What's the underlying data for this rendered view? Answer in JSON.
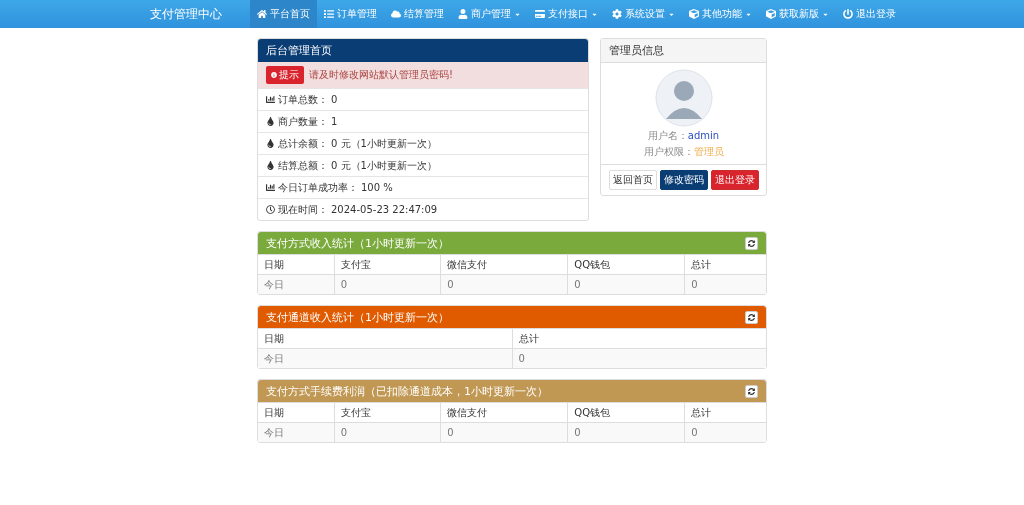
{
  "navbar": {
    "brand": "支付管理中心",
    "items": [
      {
        "label": "平台首页",
        "kind": "home",
        "dropdown": false,
        "selected": true
      },
      {
        "label": "订单管理",
        "kind": "list",
        "dropdown": false,
        "selected": false
      },
      {
        "label": "结算管理",
        "kind": "cloud",
        "dropdown": false,
        "selected": false
      },
      {
        "label": "商户管理",
        "kind": "user",
        "dropdown": true,
        "selected": false
      },
      {
        "label": "支付接口",
        "kind": "card",
        "dropdown": true,
        "selected": false
      },
      {
        "label": "系统设置",
        "kind": "cog",
        "dropdown": true,
        "selected": false
      },
      {
        "label": "其他功能",
        "kind": "cube",
        "dropdown": true,
        "selected": false
      },
      {
        "label": "获取新版",
        "kind": "cube",
        "dropdown": true,
        "selected": false
      },
      {
        "label": "退出登录",
        "kind": "power",
        "dropdown": false,
        "selected": false
      }
    ]
  },
  "overview": {
    "title": "后台管理首页",
    "alert": {
      "badge": "提示",
      "message": "请及时修改网站默认管理员密码!"
    },
    "rows": [
      {
        "kind": "chart",
        "label": "订单总数：",
        "value": "0"
      },
      {
        "kind": "drop",
        "label": "商户数量：",
        "value": "1"
      },
      {
        "kind": "drop",
        "label": "总计余额：",
        "value": "0 元（1小时更新一次）"
      },
      {
        "kind": "drop",
        "label": "结算总额：",
        "value": "0 元（1小时更新一次）"
      },
      {
        "kind": "chart",
        "label": "今日订单成功率：",
        "value": "100 %"
      },
      {
        "kind": "clock",
        "label": "现在时间：",
        "value": "2024-05-23 22:47:09"
      }
    ]
  },
  "admin": {
    "title": "管理员信息",
    "username_label": "用户名：",
    "username": "admin",
    "role_label": "用户权限：",
    "role": "管理员",
    "buttons": [
      {
        "label": "返回首页",
        "kind": "default"
      },
      {
        "label": "修改密码",
        "kind": "primary"
      },
      {
        "label": "退出登录",
        "kind": "danger"
      }
    ]
  },
  "panels": [
    {
      "title": "支付方式收入统计（1小时更新一次）",
      "color": "#7aa93c",
      "columns": [
        "日期",
        "支付宝",
        "微信支付",
        "QQ钱包",
        "总计"
      ],
      "rows": [
        [
          "今日",
          "0",
          "0",
          "0",
          "0"
        ]
      ]
    },
    {
      "title": "支付通道收入统计（1小时更新一次）",
      "color": "#e05a00",
      "columns": [
        "日期",
        "总计"
      ],
      "rows": [
        [
          "今日",
          "0"
        ]
      ]
    },
    {
      "title": "支付方式手续费利润（已扣除通道成本，1小时更新一次）",
      "color": "#c09853",
      "columns": [
        "日期",
        "支付宝",
        "微信支付",
        "QQ钱包",
        "总计"
      ],
      "rows": [
        [
          "今日",
          "0",
          "0",
          "0",
          "0"
        ]
      ]
    }
  ]
}
